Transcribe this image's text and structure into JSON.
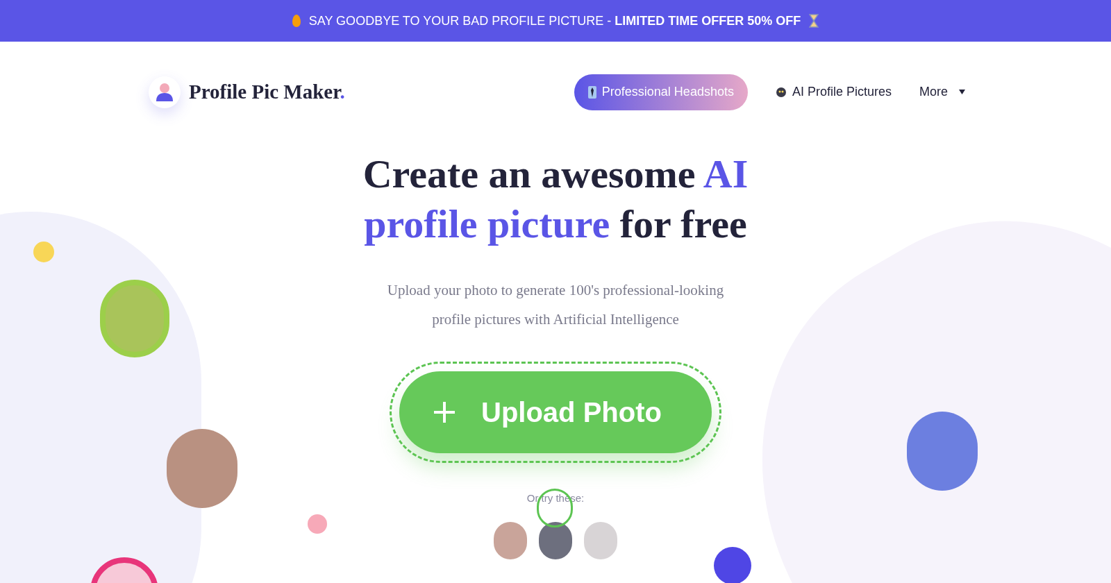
{
  "banner": {
    "text": "SAY GOODBYE TO YOUR BAD PROFILE PICTURE - **LIMITED TIME OFFER 50% OFF**"
  },
  "logo": {
    "text": "Profile Pic Maker",
    "dot": "."
  },
  "nav": [
    {
      "kind": "pill",
      "label": "Professional Headshots"
    },
    {
      "kind": "link",
      "label": "AI Profile Pictures"
    },
    {
      "kind": "dropdown",
      "label": "More"
    }
  ],
  "hero": {
    "headline": [
      {
        "text": "Create an awesome ",
        "highlight": false
      },
      {
        "text": "AI profile picture",
        "highlight": true
      },
      {
        "text": " for free",
        "highlight": false
      }
    ],
    "subtitle": "Upload your photo to generate 100's professional-looking profile pictures with Artificial Intelligence",
    "upload_button": "Upload Photo",
    "samples_label": "Or try these:"
  }
}
